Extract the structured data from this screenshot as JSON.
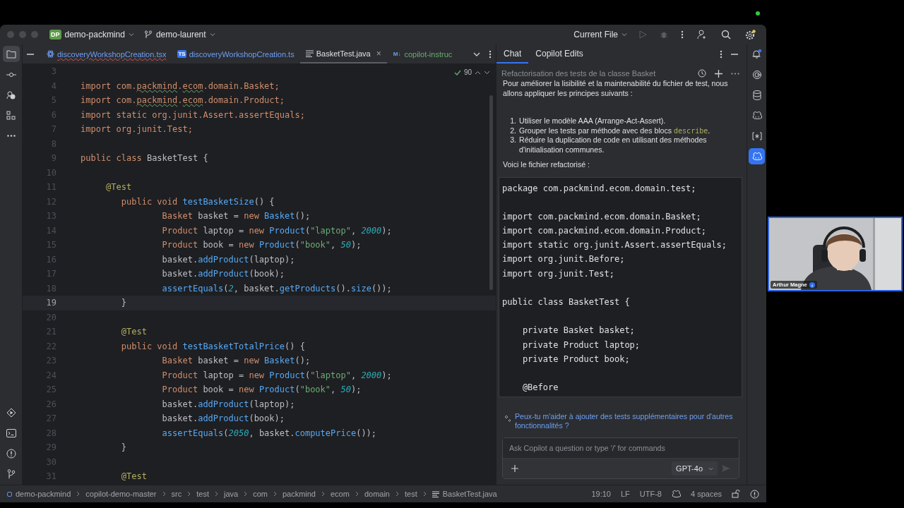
{
  "window": {
    "project_badge": "DP",
    "project": "demo-packmind",
    "branch": "demo-laurent",
    "run_config": "Current File"
  },
  "left_toolbar": {
    "top": [
      {
        "selected": true
      },
      {
        "selected": false
      },
      {
        "selected": false
      },
      {
        "selected": false
      },
      {
        "selected": false
      }
    ],
    "bottom": [
      {
        "selected": false
      },
      {
        "selected": false
      },
      {
        "selected": false
      },
      {
        "selected": false
      }
    ]
  },
  "tabs": [
    {
      "label": "discoveryWorkshopCreation.tsx",
      "kind": "tsx",
      "selected": false,
      "color": "#6f9ff5",
      "error": true
    },
    {
      "label": "discoveryWorkshopCreation.ts",
      "kind": "ts",
      "icon_text": "TS",
      "selected": false,
      "color": "#6f9ff5",
      "error": false
    },
    {
      "label": "BasketTest.java",
      "kind": "java",
      "selected": true,
      "color": "#dfe1e5",
      "error": false,
      "close": "×"
    },
    {
      "label": "copilot-instruc",
      "kind": "md",
      "icon_text": "M↓",
      "selected": false,
      "color": "#6aab73",
      "error": false
    }
  ],
  "editor": {
    "inspection_count": "90",
    "lines": [
      {
        "number": "3",
        "current": false
      },
      {
        "number": "4",
        "current": false,
        "tokens": [
          {
            "kind": "keyword",
            "text": "import com."
          },
          {
            "kind": "warning",
            "text": "packmind"
          },
          {
            "kind": "keyword",
            "text": "."
          },
          {
            "kind": "warning",
            "text": "ecom"
          },
          {
            "kind": "keyword",
            "text": ".domain.Basket;"
          }
        ]
      },
      {
        "number": "5",
        "current": false,
        "tokens": [
          {
            "kind": "keyword",
            "text": "import com."
          },
          {
            "kind": "warning",
            "text": "packmind"
          },
          {
            "kind": "keyword",
            "text": "."
          },
          {
            "kind": "warning",
            "text": "ecom"
          },
          {
            "kind": "keyword",
            "text": ".domain.Product;"
          }
        ]
      },
      {
        "number": "6",
        "current": false,
        "tokens": [
          {
            "kind": "keyword",
            "text": "import static org.junit.Assert.assertEquals;"
          }
        ]
      },
      {
        "number": "7",
        "current": false,
        "tokens": [
          {
            "kind": "keyword",
            "text": "import org.junit.Test;"
          }
        ]
      },
      {
        "number": "8",
        "current": false
      },
      {
        "number": "9",
        "current": false,
        "tokens": [
          {
            "kind": "keyword",
            "text": "public class "
          },
          {
            "kind": "plain",
            "text": "BasketTest {"
          }
        ]
      },
      {
        "number": "10",
        "current": false
      },
      {
        "number": "11",
        "current": false,
        "tokens": [
          {
            "kind": "annotation",
            "text": "     @Test"
          }
        ]
      },
      {
        "number": "12",
        "current": false,
        "tokens": [
          {
            "kind": "keyword",
            "text": "        public void "
          },
          {
            "kind": "call",
            "text": "testBasketSize"
          },
          {
            "kind": "plain",
            "text": "() {"
          }
        ]
      },
      {
        "number": "13",
        "current": false,
        "tokens": [
          {
            "kind": "keyword",
            "text": "                Basket "
          },
          {
            "kind": "plain",
            "text": "basket = "
          },
          {
            "kind": "keyword",
            "text": "new "
          },
          {
            "kind": "call",
            "text": "Basket"
          },
          {
            "kind": "plain",
            "text": "();"
          }
        ]
      },
      {
        "number": "14",
        "current": false,
        "tokens": [
          {
            "kind": "keyword",
            "text": "                Product "
          },
          {
            "kind": "plain",
            "text": "laptop = "
          },
          {
            "kind": "keyword",
            "text": "new "
          },
          {
            "kind": "call",
            "text": "Product"
          },
          {
            "kind": "plain",
            "text": "("
          },
          {
            "kind": "string",
            "text": "\"laptop\""
          },
          {
            "kind": "plain",
            "text": ", "
          },
          {
            "kind": "number",
            "text": "2000"
          },
          {
            "kind": "plain",
            "text": ");"
          }
        ]
      },
      {
        "number": "15",
        "current": false,
        "tokens": [
          {
            "kind": "keyword",
            "text": "                Product "
          },
          {
            "kind": "plain",
            "text": "book = "
          },
          {
            "kind": "keyword",
            "text": "new "
          },
          {
            "kind": "call",
            "text": "Product"
          },
          {
            "kind": "plain",
            "text": "("
          },
          {
            "kind": "string",
            "text": "\"book\""
          },
          {
            "kind": "plain",
            "text": ", "
          },
          {
            "kind": "number",
            "text": "50"
          },
          {
            "kind": "plain",
            "text": ");"
          }
        ]
      },
      {
        "number": "16",
        "current": false,
        "tokens": [
          {
            "kind": "plain",
            "text": "                basket."
          },
          {
            "kind": "call",
            "text": "addProduct"
          },
          {
            "kind": "plain",
            "text": "(laptop);"
          }
        ]
      },
      {
        "number": "17",
        "current": false,
        "tokens": [
          {
            "kind": "plain",
            "text": "                basket."
          },
          {
            "kind": "call",
            "text": "addProduct"
          },
          {
            "kind": "plain",
            "text": "(book);"
          }
        ]
      },
      {
        "number": "18",
        "current": false,
        "tokens": [
          {
            "kind": "call",
            "text": "                assertEquals"
          },
          {
            "kind": "plain",
            "text": "("
          },
          {
            "kind": "number",
            "text": "2"
          },
          {
            "kind": "plain",
            "text": ", basket."
          },
          {
            "kind": "call",
            "text": "getProducts"
          },
          {
            "kind": "plain",
            "text": "()."
          },
          {
            "kind": "call",
            "text": "size"
          },
          {
            "kind": "plain",
            "text": "());"
          }
        ]
      },
      {
        "number": "19",
        "current": true,
        "tokens": [
          {
            "kind": "plain",
            "text": "        }"
          }
        ]
      },
      {
        "number": "20",
        "current": false
      },
      {
        "number": "21",
        "current": false,
        "tokens": [
          {
            "kind": "annotation",
            "text": "        @Test"
          }
        ]
      },
      {
        "number": "22",
        "current": false,
        "tokens": [
          {
            "kind": "keyword",
            "text": "        public void "
          },
          {
            "kind": "call",
            "text": "testBasketTotalPrice"
          },
          {
            "kind": "plain",
            "text": "() {"
          }
        ]
      },
      {
        "number": "23",
        "current": false,
        "tokens": [
          {
            "kind": "keyword",
            "text": "                Basket "
          },
          {
            "kind": "plain",
            "text": "basket = "
          },
          {
            "kind": "keyword",
            "text": "new "
          },
          {
            "kind": "call",
            "text": "Basket"
          },
          {
            "kind": "plain",
            "text": "();"
          }
        ]
      },
      {
        "number": "24",
        "current": false,
        "tokens": [
          {
            "kind": "keyword",
            "text": "                Product "
          },
          {
            "kind": "plain",
            "text": "laptop = "
          },
          {
            "kind": "keyword",
            "text": "new "
          },
          {
            "kind": "call",
            "text": "Product"
          },
          {
            "kind": "plain",
            "text": "("
          },
          {
            "kind": "string",
            "text": "\"laptop\""
          },
          {
            "kind": "plain",
            "text": ", "
          },
          {
            "kind": "number",
            "text": "2000"
          },
          {
            "kind": "plain",
            "text": ");"
          }
        ]
      },
      {
        "number": "25",
        "current": false,
        "tokens": [
          {
            "kind": "keyword",
            "text": "                Product "
          },
          {
            "kind": "plain",
            "text": "book = "
          },
          {
            "kind": "keyword",
            "text": "new "
          },
          {
            "kind": "call",
            "text": "Product"
          },
          {
            "kind": "plain",
            "text": "("
          },
          {
            "kind": "string",
            "text": "\"book\""
          },
          {
            "kind": "plain",
            "text": ", "
          },
          {
            "kind": "number",
            "text": "50"
          },
          {
            "kind": "plain",
            "text": ");"
          }
        ]
      },
      {
        "number": "26",
        "current": false,
        "tokens": [
          {
            "kind": "plain",
            "text": "                basket."
          },
          {
            "kind": "call",
            "text": "addProduct"
          },
          {
            "kind": "plain",
            "text": "(laptop);"
          }
        ]
      },
      {
        "number": "27",
        "current": false,
        "tokens": [
          {
            "kind": "plain",
            "text": "                basket."
          },
          {
            "kind": "call",
            "text": "addProduct"
          },
          {
            "kind": "plain",
            "text": "(book);"
          }
        ]
      },
      {
        "number": "28",
        "current": false,
        "tokens": [
          {
            "kind": "call",
            "text": "                assertEquals"
          },
          {
            "kind": "plain",
            "text": "("
          },
          {
            "kind": "number",
            "text": "2050"
          },
          {
            "kind": "plain",
            "text": ", basket."
          },
          {
            "kind": "call",
            "text": "computePrice"
          },
          {
            "kind": "plain",
            "text": "());"
          }
        ]
      },
      {
        "number": "29",
        "current": false,
        "tokens": [
          {
            "kind": "plain",
            "text": "        }"
          }
        ]
      },
      {
        "number": "30",
        "current": false
      },
      {
        "number": "31",
        "current": false,
        "tokens": [
          {
            "kind": "annotation",
            "text": "        @Test"
          }
        ]
      }
    ]
  },
  "chat": {
    "tabs": [
      {
        "label": "Chat",
        "selected": true
      },
      {
        "label": "Copilot Edits",
        "selected": false
      }
    ],
    "session_title": "Refactorisation des tests de la classe Basket",
    "intro": "Pour améliorer la lisibilité et la maintenabilité du fichier de test, nous allons appliquer les principes suivants :",
    "steps": [
      {
        "number": "1.",
        "text": "Utiliser le modèle AAA (Arrange-Act-Assert)."
      },
      {
        "number": "2.",
        "text": "Grouper les tests par méthode avec des blocs ",
        "code": "describe",
        "after": "."
      },
      {
        "number": "3.",
        "text": "Réduire la duplication de code en utilisant des méthodes d'initialisation communes."
      }
    ],
    "outro": "Voici le fichier refactorisé :",
    "code_block": [
      [
        "package com.packmind.ecom.domain.test;"
      ],
      [
        "import com.packmind.ecom.domain.Basket;",
        "import com.packmind.ecom.domain.Product;",
        "import static org.junit.Assert.assertEquals;",
        "import org.junit.Before;",
        "import org.junit.Test;"
      ],
      [
        "public class BasketTest {"
      ],
      [
        "    private Basket basket;",
        "    private Product laptop;",
        "    private Product book;"
      ],
      [
        "    @Before"
      ]
    ],
    "suggestion": "Peux-tu m'aider à ajouter des tests supplémentaires pour d'autres fonctionnalités ?",
    "input": {
      "placeholder": "Ask Copilot a question or type '/' for commands",
      "model": "GPT-4o",
      "send_disabled": true
    }
  },
  "right_toolbar": [
    {
      "selected": false
    },
    {
      "selected": false
    },
    {
      "selected": false
    },
    {
      "selected": false
    },
    {
      "selected": false
    },
    {
      "selected": true
    }
  ],
  "status_bar": {
    "breadcrumbs": [
      "demo-packmind",
      "copilot-demo-master",
      "src",
      "test",
      "java",
      "com",
      "packmind",
      "ecom",
      "domain",
      "test",
      "BasketTest.java"
    ],
    "position": "19:10",
    "line_ending": "LF",
    "encoding": "UTF-8",
    "indent": "4 spaces"
  },
  "webcam": {
    "kind": "picture",
    "name": "Arthur Magne"
  }
}
